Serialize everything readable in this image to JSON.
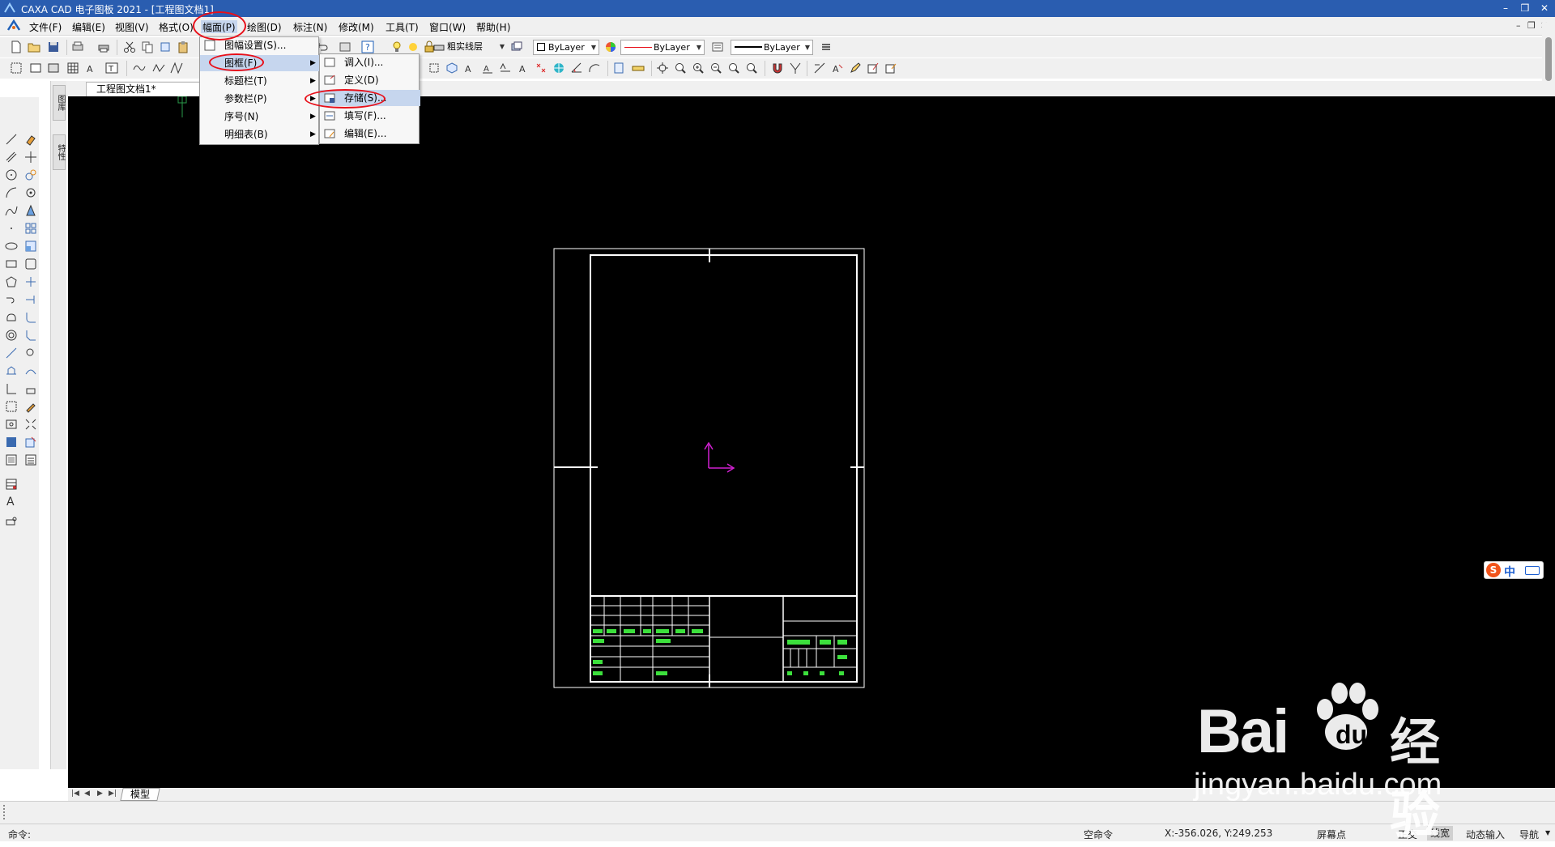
{
  "window": {
    "title": "CAXA CAD 电子图板 2021 - [工程图文档1]",
    "controls": [
      "–",
      "❒",
      "✕"
    ],
    "mdi_controls": [
      "–",
      "❒",
      "✕"
    ]
  },
  "menubar": {
    "items": [
      {
        "label": "文件(F)"
      },
      {
        "label": "编辑(E)"
      },
      {
        "label": "视图(V)"
      },
      {
        "label": "格式(O)"
      },
      {
        "label": "幅面(P)"
      },
      {
        "label": "绘图(D)"
      },
      {
        "label": "标注(N)"
      },
      {
        "label": "修改(M)"
      },
      {
        "label": "工具(T)"
      },
      {
        "label": "窗口(W)"
      },
      {
        "label": "帮助(H)"
      }
    ]
  },
  "properties": {
    "linetype_label": "粗实线层",
    "color_layer": "ByLayer",
    "linetype_layer": "ByLayer",
    "lineweight_layer": "ByLayer",
    "accent_red": "#e8101a"
  },
  "document": {
    "tab_label": "工程图文档1*",
    "close_glyph": "×",
    "add_glyph": "+"
  },
  "side_panel": {
    "tabs": [
      "图库",
      "特性"
    ]
  },
  "menu_fumian": {
    "items": [
      {
        "label": "图幅设置(S)...",
        "submenu": false
      },
      {
        "label": "图框(F)",
        "submenu": true
      },
      {
        "label": "标题栏(T)",
        "submenu": true
      },
      {
        "label": "参数栏(P)",
        "submenu": true
      },
      {
        "label": "序号(N)",
        "submenu": true
      },
      {
        "label": "明细表(B)",
        "submenu": true
      }
    ],
    "submenu_glyph": "▶"
  },
  "menu_tukuang": {
    "items": [
      {
        "label": "调入(I)..."
      },
      {
        "label": "定义(D)"
      },
      {
        "label": "存储(S)..."
      },
      {
        "label": "填写(F)..."
      },
      {
        "label": "编辑(E)..."
      }
    ]
  },
  "sheet": {
    "model_tab": "模型",
    "nav": [
      "|◀",
      "◀",
      "▶",
      "▶|"
    ]
  },
  "command": {
    "prompt": "命令:"
  },
  "status": {
    "state": "空命令",
    "coords": "X:-356.026, Y:249.253",
    "snap": "屏幕点",
    "ortho": "正交",
    "lineweight": "线宽",
    "dynamic_input": "动态输入",
    "navigation": "导航"
  },
  "ime": {
    "label": "中"
  },
  "watermark": {
    "brand_a": "Bai",
    "brand_b": "经验",
    "url": "jingyan.baidu.com"
  }
}
